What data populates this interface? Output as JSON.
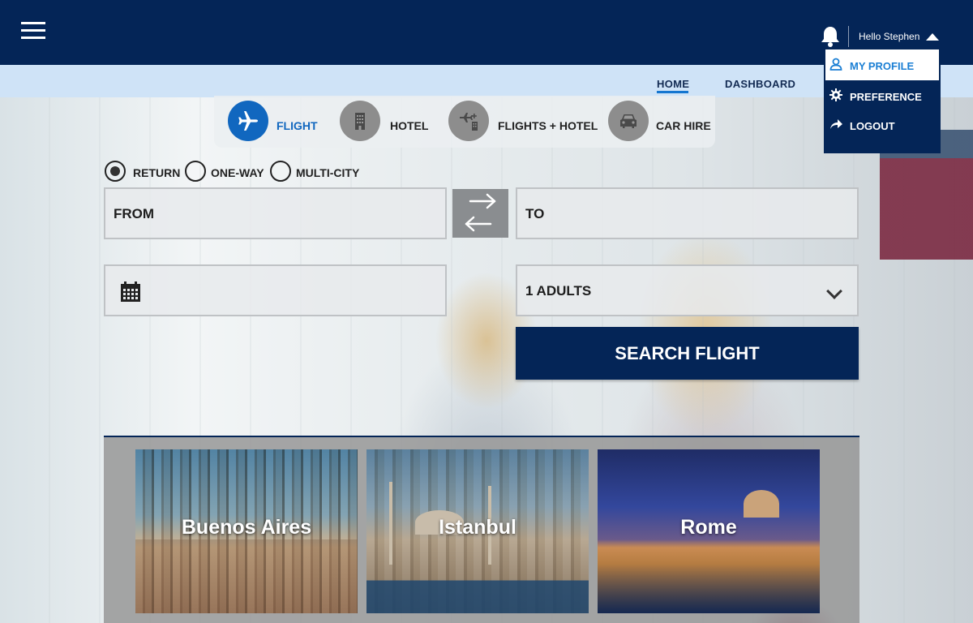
{
  "header": {
    "greeting": "Hello Stephen"
  },
  "nav": {
    "home": "HOME",
    "dashboard": "DASHBOARD"
  },
  "profile_menu": {
    "items": [
      {
        "label": "MY PROFILE",
        "icon": "user-icon"
      },
      {
        "label": "PREFERENCE",
        "icon": "gear-icon"
      },
      {
        "label": "LOGOUT",
        "icon": "share-arrow-icon"
      }
    ]
  },
  "tabs": [
    {
      "label": "FLIGHT",
      "icon": "airplane-icon",
      "active": true
    },
    {
      "label": "HOTEL",
      "icon": "hotel-icon",
      "active": false
    },
    {
      "label": "FLIGHTS + HOTEL",
      "icon": "flight-plus-hotel-icon",
      "active": false
    },
    {
      "label": "CAR HIRE",
      "icon": "car-icon",
      "active": false
    }
  ],
  "trip_types": [
    {
      "label": "RETURN",
      "checked": true
    },
    {
      "label": "ONE-WAY",
      "checked": false
    },
    {
      "label": "MULTI-CITY",
      "checked": false
    }
  ],
  "form": {
    "from": "FROM",
    "to": "TO",
    "passengers": "1 ADULTS",
    "search_button": "SEARCH FLIGHT"
  },
  "destinations": [
    {
      "name": "Buenos Aires"
    },
    {
      "name": "Istanbul"
    },
    {
      "name": "Rome"
    }
  ],
  "colors": {
    "navy": "#042557",
    "accent_blue": "#1167bf",
    "subnav_bg": "#cfe3f7"
  }
}
